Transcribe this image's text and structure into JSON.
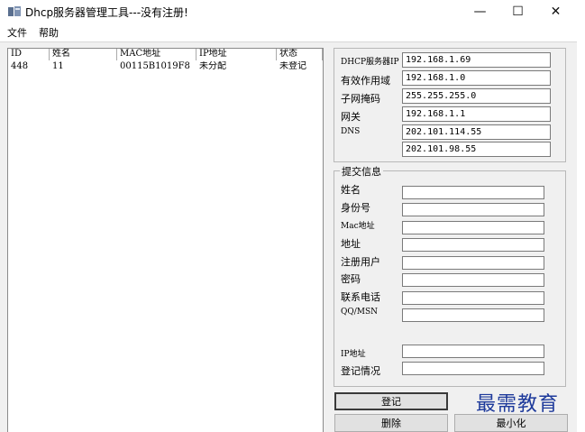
{
  "window": {
    "title": "Dhcp服务器管理工具---没有注册!",
    "minimize": "—",
    "maximize": "☐",
    "close": "✕"
  },
  "menu": {
    "file": "文件",
    "help": "帮助"
  },
  "list": {
    "columns": [
      "ID",
      "姓名",
      "MAC地址",
      "IP地址",
      "状态"
    ],
    "rows": [
      {
        "id": "448",
        "name": "11",
        "mac": "00115B1019F8",
        "ip": "未分配",
        "status": "未登记"
      }
    ]
  },
  "dhcp": {
    "server_ip_label": "DHCP服务器IP",
    "server_ip": "192.168.1.69",
    "scope_label": "有效作用域",
    "scope": "192.168.1.0",
    "mask_label": "子网掩码",
    "mask": "255.255.255.0",
    "gateway_label": "网关",
    "gateway": "192.168.1.1",
    "dns_label": "DNS",
    "dns1": "202.101.114.55",
    "dns2": "202.101.98.55"
  },
  "submit": {
    "group_title": "提交信息",
    "name_label": "姓名",
    "id_label": "身份号",
    "mac_label": "Mac地址",
    "address_label": "地址",
    "user_label": "注册用户",
    "password_label": "密码",
    "phone_label": "联系电话",
    "qq_label": "QQ/MSN",
    "ip_label": "IP地址",
    "reg_status_label": "登记情况"
  },
  "buttons": {
    "register": "登记",
    "delete": "删除",
    "minimize": "最小化"
  },
  "watermark": "最需教育",
  "colors": {
    "watermark": "#1e3a9b",
    "window_bg": "#f0f0f0"
  }
}
